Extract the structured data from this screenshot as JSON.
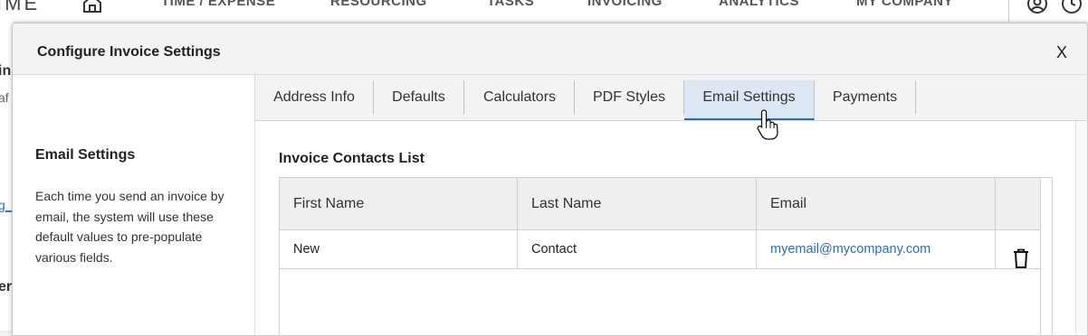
{
  "app": {
    "brand": "IME",
    "nav": [
      "TIME / EXPENSE",
      "RESOURCING",
      "TASKS",
      "INVOICING",
      "ANALYTICS",
      "MY COMPANY"
    ],
    "bg_fragments": [
      "in",
      "af",
      "g_",
      "eri"
    ]
  },
  "modal": {
    "title": "Configure Invoice Settings",
    "close_label": "X"
  },
  "side": {
    "title": "Email Settings",
    "description": "Each time you send an invoice by email, the system will use these default values to pre-populate various fields."
  },
  "tabs": [
    {
      "label": "Address Info",
      "active": false
    },
    {
      "label": "Defaults",
      "active": false
    },
    {
      "label": "Calculators",
      "active": false
    },
    {
      "label": "PDF Styles",
      "active": false
    },
    {
      "label": "Email Settings",
      "active": true
    },
    {
      "label": "Payments",
      "active": false
    }
  ],
  "contacts": {
    "title": "Invoice Contacts List",
    "columns": [
      "First Name",
      "Last Name",
      "Email"
    ],
    "rows": [
      {
        "first_name": "New",
        "last_name": "Contact",
        "email": "myemail@mycompany.com"
      }
    ]
  },
  "colors": {
    "accent": "#2c69b5",
    "link": "#2a6ebb",
    "active_tab_bg": "#dde7f3"
  },
  "icons": [
    "home-icon",
    "user-icon",
    "clock-icon",
    "trash-icon",
    "hand-cursor-icon"
  ]
}
